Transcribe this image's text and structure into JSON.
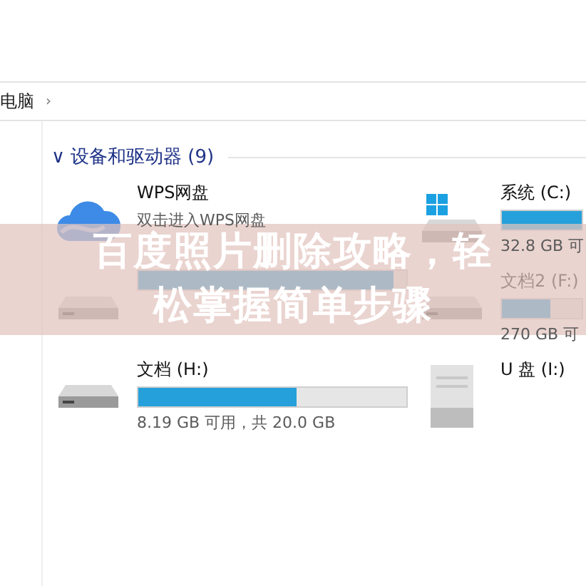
{
  "address_bar": {
    "path": "电脑",
    "separator": "›"
  },
  "section": {
    "chevron": "∨",
    "title": "设备和驱动器 (9)"
  },
  "drives_left": [
    {
      "kind": "cloud",
      "name": "WPS网盘",
      "detail": "双击进入WPS网盘"
    },
    {
      "kind": "disk",
      "level": 0.95
    },
    {
      "kind": "disk",
      "name": "文档 (H:)",
      "level": 0.59,
      "detail": "8.19 GB 可用，共 20.0 GB"
    }
  ],
  "drives_right": [
    {
      "kind": "system",
      "name": "系统 (C:)",
      "level": 1,
      "detail": "32.8 GB 可"
    },
    {
      "kind": "disk",
      "name": "文档2 (F:)",
      "level": 0.6,
      "detail": "270 GB 可"
    },
    {
      "kind": "usb",
      "name": "U 盘 (I:)"
    }
  ],
  "banner": {
    "lines": [
      "百度照片删除攻略，轻",
      "松掌握简单步骤"
    ]
  }
}
